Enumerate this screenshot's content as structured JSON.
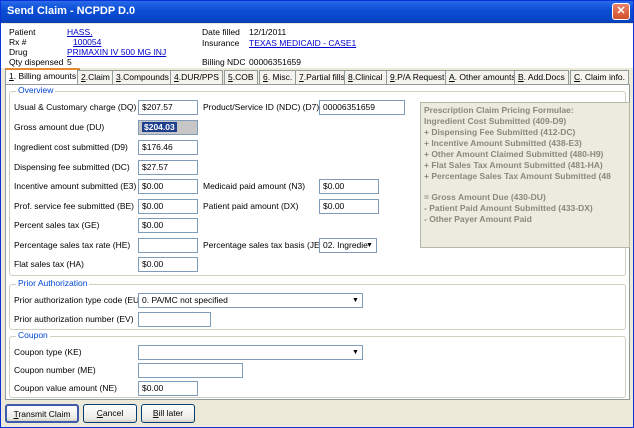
{
  "window": {
    "title": "Send Claim -  NCPDP D.0",
    "close_glyph": "✕"
  },
  "header": {
    "patient_label": "Patient",
    "patient_value": "HASS, ",
    "rx_label": "Rx #",
    "rx_value": "100054",
    "drug_label": "Drug",
    "drug_value": "PRIMAXIN IV 500 MG INJ",
    "qty_label": "Qty dispensed",
    "qty_value": "5",
    "date_label": "Date filled",
    "date_value": "12/1/2011",
    "insurance_label": "Insurance",
    "insurance_value": "TEXAS MEDICAID - CASE1",
    "ndc_label": "Billing NDC",
    "ndc_value": "00006351659"
  },
  "tabs": [
    {
      "key": "1",
      "label": ". Billing amounts"
    },
    {
      "key": "2",
      "label": ".Claim"
    },
    {
      "key": "3",
      "label": ".Compounds"
    },
    {
      "key": "4",
      "label": ".DUR/PPS"
    },
    {
      "key": "5",
      "label": ".COB"
    },
    {
      "key": "6",
      "label": ". Misc."
    },
    {
      "key": "7",
      "label": ".Partial fills"
    },
    {
      "key": "8",
      "label": ".Clinical"
    },
    {
      "key": "9",
      "label": ".P/A Request"
    },
    {
      "key": "A",
      "label": ". Other amounts"
    },
    {
      "key": "B",
      "label": ". Add.Docs"
    },
    {
      "key": "C",
      "label": ". Claim info."
    }
  ],
  "overview": {
    "legend": "Overview",
    "ucc_label": "Usual & Customary charge (DQ)",
    "ucc_value": "$207.57",
    "gross_label": "Gross amount due (DU)",
    "gross_value": "$204.03",
    "ingredient_label": "Ingredient cost submitted (D9)",
    "ingredient_value": "$176.46",
    "dispensing_label": "Dispensing fee submitted (DC)",
    "dispensing_value": "$27.57",
    "incentive_label": "Incentive amount submitted (E3)",
    "incentive_value": "$0.00",
    "prof_label": "Prof. service fee submitted (BE)",
    "prof_value": "$0.00",
    "pct_tax_label": "Percent sales tax (GE)",
    "pct_tax_value": "$0.00",
    "pct_rate_label": "Percentage sales tax rate (HE)",
    "pct_rate_value": "",
    "flat_tax_label": "Flat sales tax (HA)",
    "flat_tax_value": "$0.00",
    "ndc_id_label": "Product/Service ID (NDC) (D7)",
    "ndc_id_value": "00006351659",
    "medicaid_label": "Medicaid paid amount (N3)",
    "medicaid_value": "$0.00",
    "patient_paid_label": "Patient paid amount (DX)",
    "patient_paid_value": "$0.00",
    "basis_label": "Percentage sales tax basis (JE)",
    "basis_value": "02. Ingredie"
  },
  "formula": {
    "lines": [
      "Prescription Claim Pricing Formulae:",
      "  Ingredient Cost Submitted (409-D9)",
      "  + Dispensing Fee Submitted (412-DC)",
      "  + Incentive Amount Submitted (438-E3)",
      "  + Other Amount Claimed Submitted (480-H9)",
      "  + Flat Sales Tax Amount Submitted (481-HA)",
      "  + Percentage Sales Tax Amount Submitted (48",
      "",
      "  = Gross Amount Due (430-DU)",
      "  - Patient Paid Amount Submitted (433-DX)",
      "  - Other Payer Amount Paid"
    ]
  },
  "prior_auth": {
    "legend": "Prior Authorization",
    "type_label": "Prior authorization type code (EU)",
    "type_value": "0. PA/MC not specified",
    "number_label": "Prior authorization number (EV)",
    "number_value": ""
  },
  "coupon": {
    "legend": "Coupon",
    "type_label": "Coupon type (KE)",
    "type_value": "",
    "number_label": "Coupon number (ME)",
    "number_value": "",
    "value_label": "Coupon value amount (NE)",
    "value_value": "$0.00"
  },
  "buttons": {
    "transmit_key": "T",
    "transmit_rest": "ransmit Claim",
    "cancel_key": "C",
    "cancel_rest": "ancel",
    "bill_key": "B",
    "bill_rest": "ill later"
  },
  "dropdown_arrow": "▼"
}
